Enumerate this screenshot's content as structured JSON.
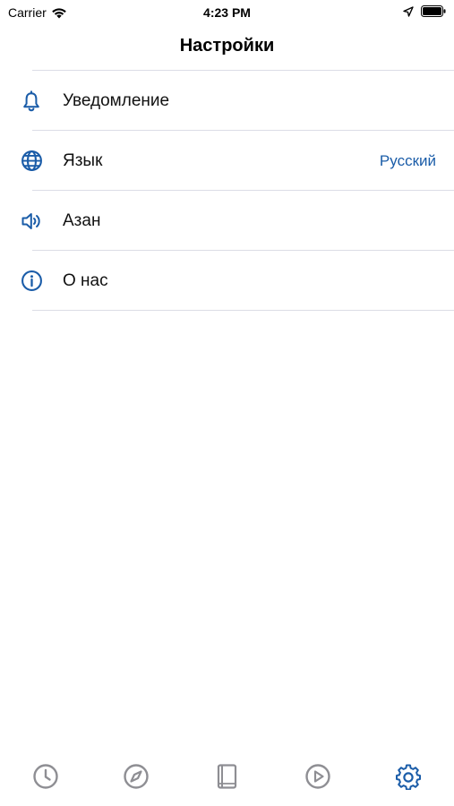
{
  "status_bar": {
    "carrier": "Carrier",
    "time": "4:23 PM"
  },
  "nav": {
    "title": "Настройки"
  },
  "settings": {
    "items": [
      {
        "icon": "bell-icon",
        "label": "Уведомление",
        "value": ""
      },
      {
        "icon": "globe-icon",
        "label": "Язык",
        "value": "Русский"
      },
      {
        "icon": "speaker-icon",
        "label": "Азан",
        "value": ""
      },
      {
        "icon": "info-icon",
        "label": "О нас",
        "value": ""
      }
    ]
  },
  "tab_bar": {
    "tabs": [
      {
        "icon": "clock-icon",
        "active": false
      },
      {
        "icon": "compass-icon",
        "active": false
      },
      {
        "icon": "book-icon",
        "active": false
      },
      {
        "icon": "play-icon",
        "active": false
      },
      {
        "icon": "gear-icon",
        "active": true
      }
    ]
  },
  "colors": {
    "accent": "#1a5ca8",
    "inactive": "#8e8e93",
    "divider": "#dcdde6"
  }
}
